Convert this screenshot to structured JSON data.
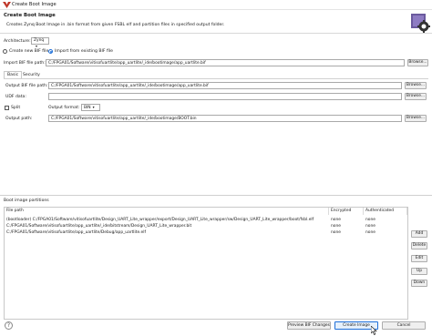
{
  "window": {
    "title": "Create Boot Image"
  },
  "header": {
    "title": "Create Boot Image",
    "description": "Creates Zynq Boot Image in .bin format from given FSBL elf and partition files in specified output folder."
  },
  "form": {
    "architecture_label": "Architecture:",
    "architecture_value": "Zynq",
    "create_bif_label": "Create new BIF file",
    "import_bif_label": "Import from existing BIF file",
    "import_bif_path_label": "Import BIF file path:",
    "import_bif_path_value": "C:/FPGA01/Software/vitisofuartlite/app_uartlite/_ide/bootimage/app_uartlite.bif",
    "browse_label": "Browse..."
  },
  "tabs": [
    {
      "label": "Basic"
    },
    {
      "label": "Security"
    }
  ],
  "basic": {
    "output_bif_label": "Output BIF file path:",
    "output_bif_value": "C:/FPGA01/Software/vitisofuartlite/app_uartlite/_ide/bootimage/app_uartlite.bif",
    "udf_label": "UDF data:",
    "udf_value": "",
    "split_label": "Split",
    "output_format_label": "Output format:",
    "output_format_value": "BIN",
    "output_path_label": "Output path:",
    "output_path_value": "C:/FPGA01/Software/vitisofuartlite/app_uartlite/_ide/bootimage/BOOT.bin"
  },
  "partitions": {
    "title": "Boot image partitions",
    "columns": [
      "File path",
      "Encrypted",
      "Authenticated"
    ],
    "rows": [
      {
        "path": "(bootloader) C:/FPGA01/Software/vitisofuartlite/Design_UART_Lite_wrapper/export/Design_UART_Lite_wrapper/sw/Design_UART_Lite_wrapper/boot/fsbl.elf",
        "encrypted": "none",
        "authenticated": "none"
      },
      {
        "path": "C:/FPGA01/Software/vitisofuartlite/app_uartlite/_ide/bitstream/Design_UART_Lite_wrapper.bit",
        "encrypted": "none",
        "authenticated": "none"
      },
      {
        "path": "C:/FPGA01/Software/vitisofuartlite/app_uartlite/Debug/app_uartlite.elf",
        "encrypted": "none",
        "authenticated": "none"
      }
    ],
    "buttons": {
      "add": "Add",
      "delete": "Delete",
      "edit": "Edit",
      "up": "Up",
      "down": "Down"
    }
  },
  "footer": {
    "preview_label": "Preview BIF Changes",
    "create_label": "Create Image",
    "cancel_label": "Cancel"
  },
  "colors": {
    "accent": "#1e6fd9",
    "title_icon": "#c0392b"
  }
}
